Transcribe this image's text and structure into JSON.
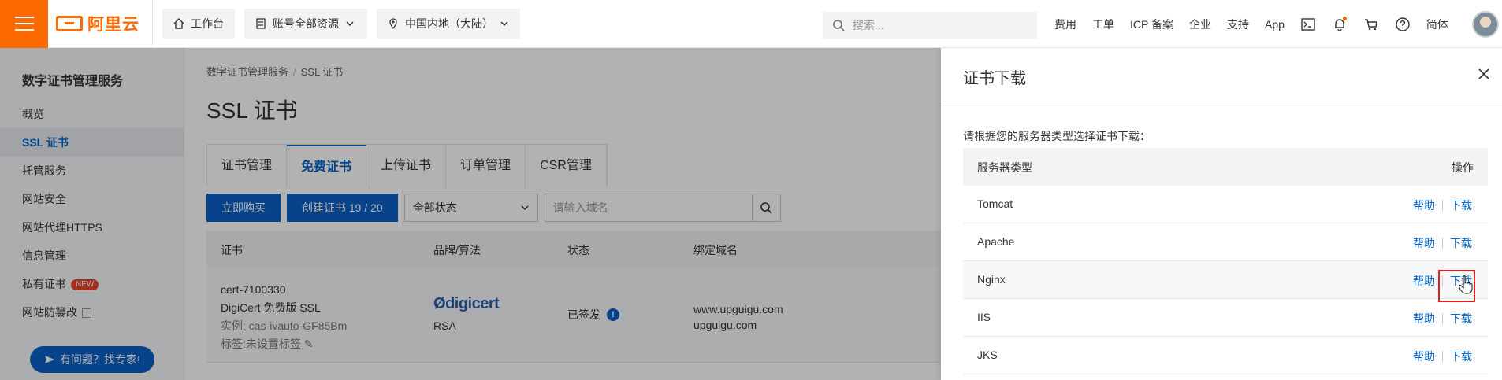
{
  "topbar": {
    "logo_text": "阿里云",
    "workbench": "工作台",
    "account_resources": "账号全部资源",
    "region": "中国内地（大陆）",
    "search_placeholder": "搜索...",
    "links": [
      "费用",
      "工单",
      "ICP 备案",
      "企业",
      "支持",
      "App"
    ],
    "language": "简体"
  },
  "sidebar": {
    "title": "数字证书管理服务",
    "items": [
      {
        "label": "概览"
      },
      {
        "label": "SSL 证书"
      },
      {
        "label": "托管服务"
      },
      {
        "label": "网站安全"
      },
      {
        "label": "网站代理HTTPS"
      },
      {
        "label": "信息管理"
      },
      {
        "label": "私有证书",
        "badge": "NEW"
      },
      {
        "label": "网站防篡改"
      }
    ],
    "help_label": "有问题？找专家!"
  },
  "main": {
    "breadcrumb": [
      "数字证书管理服务",
      "SSL 证书"
    ],
    "title": "SSL 证书",
    "tabs": [
      "证书管理",
      "免费证书",
      "上传证书",
      "订单管理",
      "CSR管理"
    ],
    "buy_label": "立即购买",
    "create_label": "创建证书 19 / 20",
    "status_filter": "全部状态",
    "domain_placeholder": "请输入域名",
    "columns": [
      "证书",
      "品牌/算法",
      "状态",
      "绑定域名"
    ],
    "row": {
      "cert_id": "cert-7100330",
      "cert_type": "DigiCert 免费版 SSL",
      "instance": "实例: cas-ivauto-GF85Bm",
      "tag": "标签:未设置标签",
      "brand": "digicert",
      "algorithm": "RSA",
      "status": "已签发",
      "domains": [
        "www.upguigu.com",
        "upguigu.com"
      ]
    }
  },
  "drawer": {
    "title": "证书下载",
    "hint": "请根据您的服务器类型选择证书下载：",
    "col_server": "服务器类型",
    "col_action": "操作",
    "help_label": "帮助",
    "download_label": "下载",
    "servers": [
      "Tomcat",
      "Apache",
      "Nginx",
      "IIS",
      "JKS"
    ]
  },
  "colors": {
    "brand_orange": "#ff6a00",
    "primary_blue": "#0a60c8",
    "highlight_red": "#e02020"
  }
}
